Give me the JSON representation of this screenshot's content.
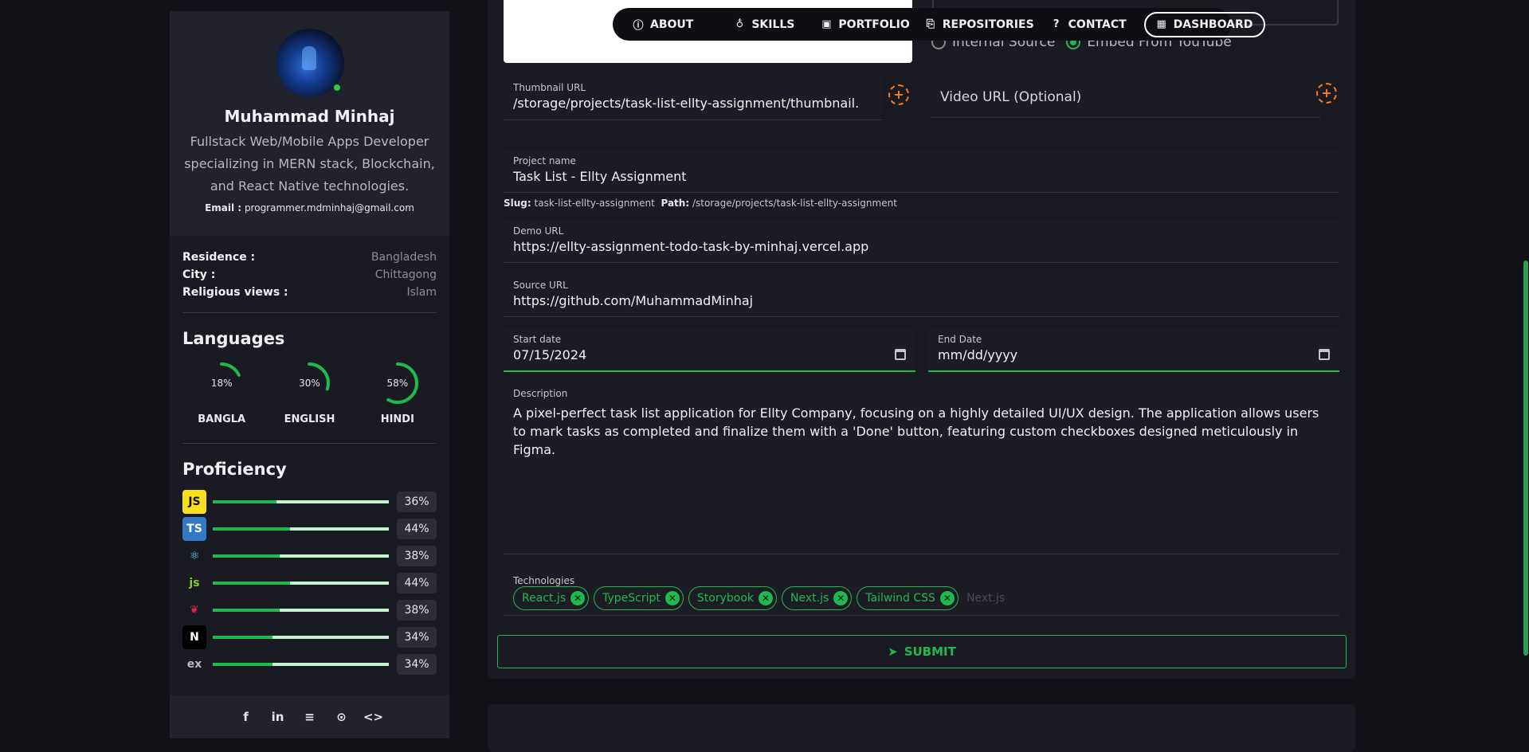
{
  "nav": {
    "items": [
      {
        "label": "ABOUT",
        "icon": "info-icon"
      },
      {
        "label": "SKILLS",
        "icon": "badge-icon"
      },
      {
        "label": "PORTFOLIO",
        "icon": "portfolio-icon"
      },
      {
        "label": "REPOSITORIES",
        "icon": "repo-icon"
      },
      {
        "label": "CONTACT",
        "icon": "help-icon"
      },
      {
        "label": "DASHBOARD",
        "icon": "dashboard-icon"
      }
    ]
  },
  "profile": {
    "name": "Muhammad Minhaj",
    "bio": "Fullstack Web/Mobile Apps Developer specializing in MERN stack, Blockchain, and React Native technologies.",
    "email_label": "Email :",
    "email": "programmer.mdminhaj@gmail.com"
  },
  "info": [
    {
      "key": "Residence :",
      "value": "Bangladesh"
    },
    {
      "key": "City :",
      "value": "Chittagong"
    },
    {
      "key": "Religious views :",
      "value": "Islam"
    }
  ],
  "languages": {
    "title": "Languages",
    "items": [
      {
        "name": "BANGLA",
        "percent_label": "18%",
        "percent": 18
      },
      {
        "name": "ENGLISH",
        "percent_label": "30%",
        "percent": 30
      },
      {
        "name": "HINDI",
        "percent_label": "58%",
        "percent": 58
      }
    ]
  },
  "proficiency": {
    "title": "Proficiency",
    "items": [
      {
        "tech": "javascript",
        "glyph": "JS",
        "bg": "#f7df1e",
        "fg": "#111111",
        "percent": 36,
        "label": "36%"
      },
      {
        "tech": "typescript",
        "glyph": "TS",
        "bg": "#3178c6",
        "fg": "#ffffff",
        "percent": 44,
        "label": "44%"
      },
      {
        "tech": "react",
        "glyph": "⚛",
        "bg": "#1a1a22",
        "fg": "#61dafb",
        "percent": 38,
        "label": "38%"
      },
      {
        "tech": "nodejs",
        "glyph": "js",
        "bg": "#1a1a22",
        "fg": "#83cd29",
        "percent": 44,
        "label": "44%"
      },
      {
        "tech": "nestjs",
        "glyph": "❦",
        "bg": "#1a1a22",
        "fg": "#e0234e",
        "percent": 38,
        "label": "38%"
      },
      {
        "tech": "nextjs",
        "glyph": "N",
        "bg": "#000000",
        "fg": "#ffffff",
        "percent": 34,
        "label": "34%"
      },
      {
        "tech": "express",
        "glyph": "ex",
        "bg": "#1a1a22",
        "fg": "#bbbbbb",
        "percent": 34,
        "label": "34%"
      }
    ]
  },
  "social": [
    "facebook-icon",
    "linkedin-icon",
    "stackoverflow-icon",
    "github-icon",
    "code-icon"
  ],
  "form": {
    "radio_internal": "Internal Source",
    "radio_youtube": "Embed From YouTube",
    "thumbnail": {
      "label": "Thumbnail URL",
      "value": "/storage/projects/task-list-ellty-assignment/thumbnail."
    },
    "video": {
      "placeholder": "Video URL (Optional)"
    },
    "project_name": {
      "label": "Project name",
      "value": "Task List - Ellty Assignment"
    },
    "slug_label": "Slug:",
    "slug": "task-list-ellty-assignment",
    "path_label": "Path:",
    "path": "/storage/projects/task-list-ellty-assignment",
    "demo": {
      "label": "Demo URL",
      "value": "https://ellty-assignment-todo-task-by-minhaj.vercel.app"
    },
    "source": {
      "label": "Source URL",
      "value": "https://github.com/MuhammadMinhaj"
    },
    "start": {
      "label": "Start date",
      "value": "07/15/2024"
    },
    "end": {
      "label": "End Date",
      "value": "mm/dd/yyyy"
    },
    "description": {
      "label": "Description",
      "value": "A pixel-perfect task list application for Ellty Company, focusing on a highly detailed UI/UX design. The application allows users to mark tasks as completed and finalize them with a 'Done' button, featuring custom checkboxes designed meticulously in Figma."
    },
    "technologies": {
      "label": "Technologies",
      "chips": [
        "React.js",
        "TypeScript",
        "Storybook",
        "Next.js",
        "Tailwind CSS"
      ],
      "input_placeholder": "Next.js"
    },
    "submit": "SUBMIT"
  },
  "colors": {
    "accent": "#1fb94f",
    "upload": "#ff7a1a",
    "background": "#111118",
    "panel": "#1a1a22"
  }
}
